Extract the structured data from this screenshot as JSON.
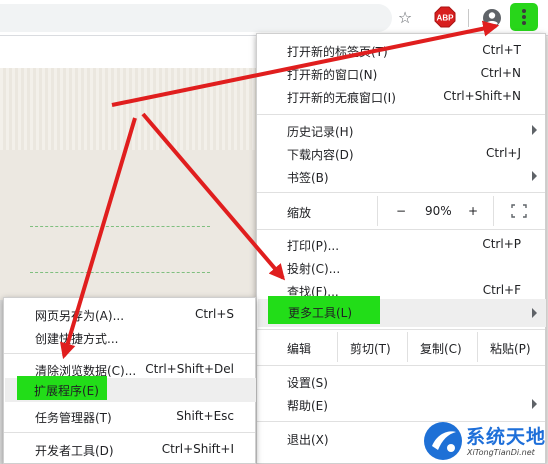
{
  "toolbar": {
    "abp_label": "ABP",
    "icons": [
      "star-icon",
      "adblock-plus-icon",
      "profile-icon",
      "chrome-menu-icon"
    ],
    "accent_highlight": "#22dd18"
  },
  "main_menu": {
    "new_tab": "打开新的标签页(T)",
    "new_tab_sc": "Ctrl+T",
    "new_window": "打开新的窗口(N)",
    "new_window_sc": "Ctrl+N",
    "incognito": "打开新的无痕窗口(I)",
    "incognito_sc": "Ctrl+Shift+N",
    "history": "历史记录(H)",
    "downloads": "下载内容(D)",
    "downloads_sc": "Ctrl+J",
    "bookmarks": "书签(B)",
    "zoom_label": "缩放",
    "zoom_minus": "−",
    "zoom_value": "90%",
    "zoom_plus": "+",
    "print": "打印(P)...",
    "print_sc": "Ctrl+P",
    "cast": "投射(C)...",
    "find": "查找(F)...",
    "find_sc": "Ctrl+F",
    "more_tools": "更多工具(L)",
    "edit_label": "编辑",
    "cut": "剪切(T)",
    "copy": "复制(C)",
    "paste": "粘贴(P)",
    "settings": "设置(S)",
    "help": "帮助(E)",
    "exit": "退出(X)"
  },
  "sub_menu": {
    "save_page": "网页另存为(A)...",
    "save_page_sc": "Ctrl+S",
    "create_shortcut": "创建快捷方式...",
    "clear_data": "清除浏览数据(C)...",
    "clear_data_sc": "Ctrl+Shift+Del",
    "extensions": "扩展程序(E)",
    "task_manager": "任务管理器(T)",
    "task_manager_sc": "Shift+Esc",
    "devtools": "开发者工具(D)",
    "devtools_sc": "Ctrl+Shift+I"
  },
  "watermark": {
    "title": "系统天地",
    "subtitle": "XiTongTianDi.net"
  }
}
